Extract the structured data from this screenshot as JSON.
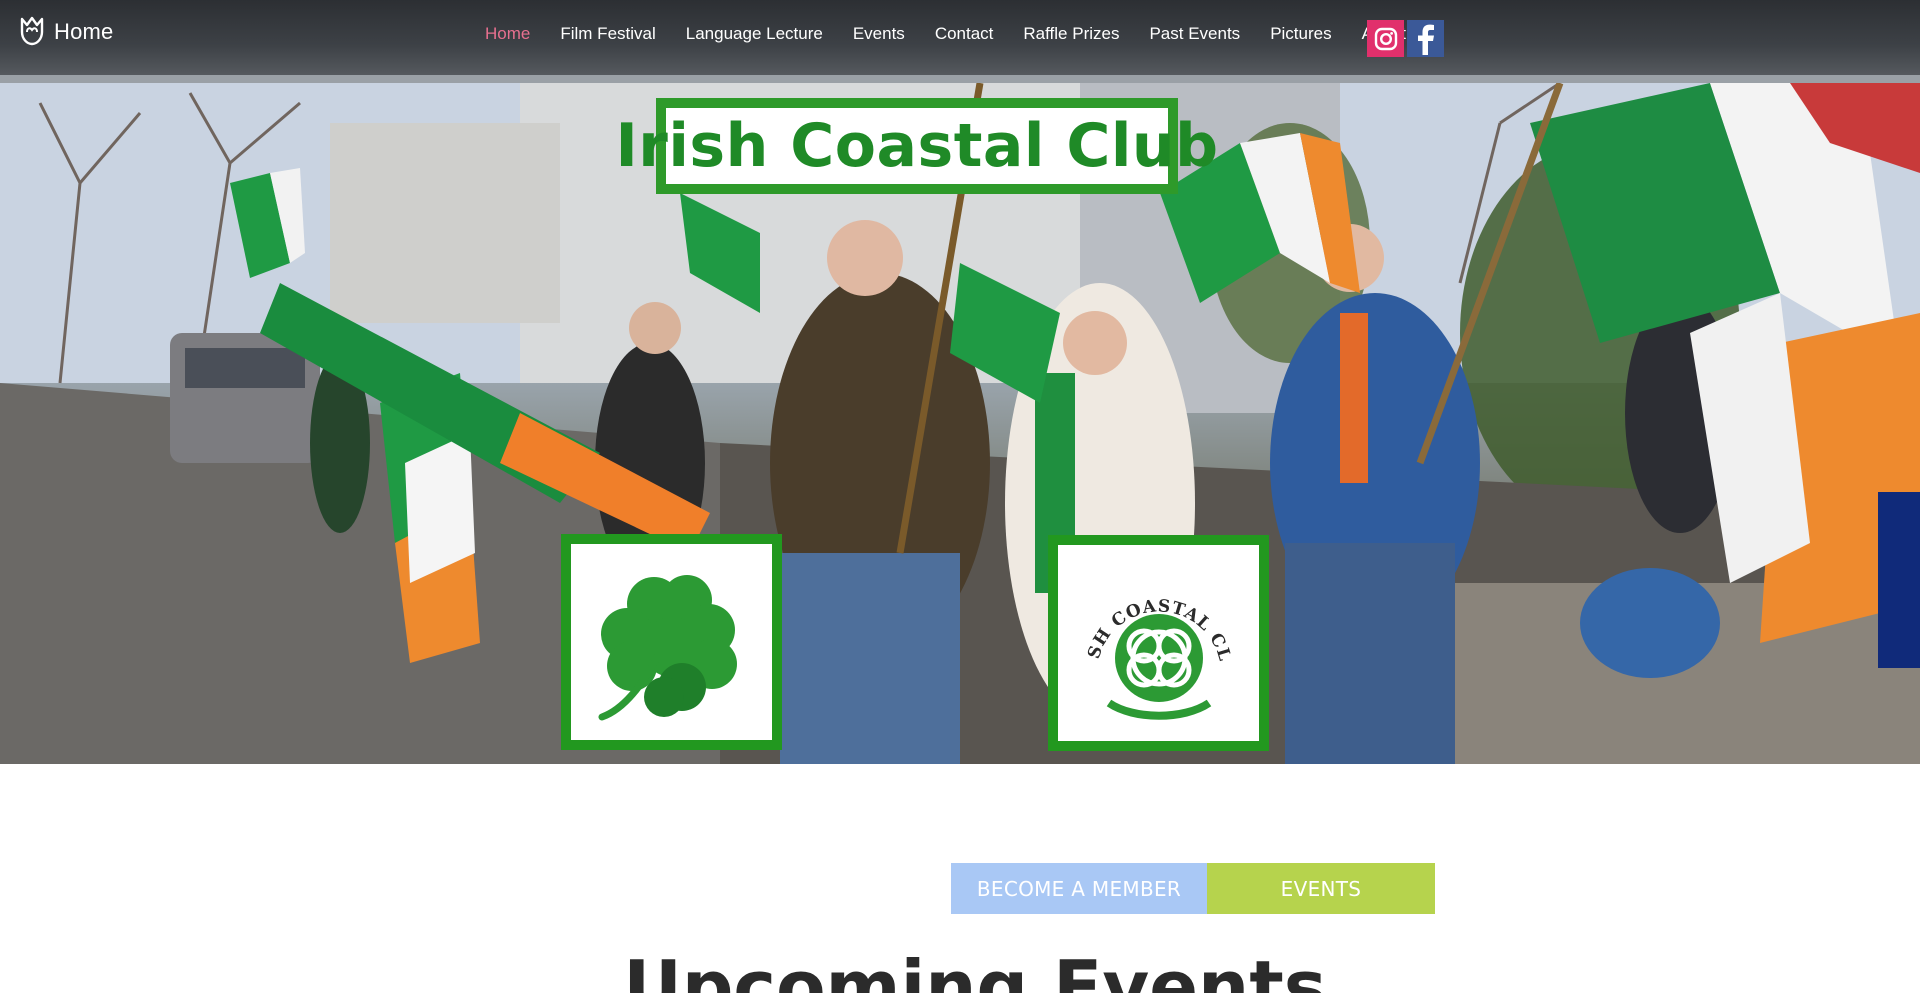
{
  "brand": {
    "label": "Home",
    "icon": "tulip-logo-icon"
  },
  "nav": {
    "items": [
      {
        "label": "Home",
        "active": true
      },
      {
        "label": "Film Festival",
        "active": false
      },
      {
        "label": "Language Lecture",
        "active": false
      },
      {
        "label": "Events",
        "active": false
      },
      {
        "label": "Contact",
        "active": false
      },
      {
        "label": "Raffle Prizes",
        "active": false
      },
      {
        "label": "Past Events",
        "active": false
      },
      {
        "label": "Pictures",
        "active": false
      },
      {
        "label": "About",
        "active": false
      }
    ],
    "active_color": "#e7708f"
  },
  "social": [
    {
      "name": "instagram",
      "icon": "instagram-icon",
      "color": "#e1306c"
    },
    {
      "name": "facebook",
      "icon": "facebook-icon",
      "color": "#3b5998"
    }
  ],
  "hero": {
    "title": "Irish Coastal Club",
    "title_color": "#1f8a27",
    "frame_color": "#2e9a2a",
    "left_badge_icon": "shamrock-icon",
    "right_badge_icon": "celtic-knot-icon",
    "right_badge_text": "IRISH COASTAL CLUB"
  },
  "cta": {
    "member_label": "BECOME A MEMBER",
    "member_color": "#a9c8f5",
    "events_label": "EVENTS",
    "events_color": "#b6d34d"
  },
  "section": {
    "heading": "Upcoming Events"
  }
}
